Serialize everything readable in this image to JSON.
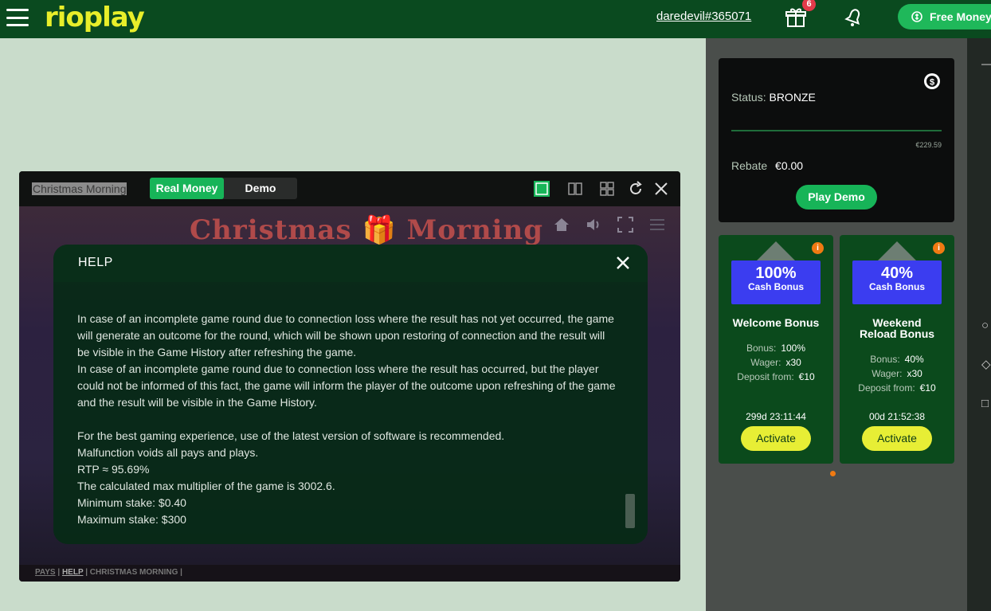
{
  "header": {
    "logo": "rioplay",
    "username": "daredevil#365071",
    "gift_badge": "6",
    "free_money_label": "Free Money"
  },
  "status_card": {
    "status_label": "Status:",
    "status_value": "BRONZE",
    "progress_fraction": 0.0,
    "progress_target": "€229.59",
    "rebate_label": "Rebate",
    "rebate_value": "€0.00",
    "play_demo_label": "Play Demo"
  },
  "bonuses": [
    {
      "pct": "100%",
      "type": "Cash Bonus",
      "title": "Welcome Bonus",
      "bonus_label": "Bonus:",
      "bonus_value": "100%",
      "wager_label": "Wager:",
      "wager_value": "x30",
      "deposit_label": "Deposit from:",
      "deposit_value": "€10",
      "timer": "299d  23:11:44",
      "activate_label": "Activate"
    },
    {
      "pct": "40%",
      "type": "Cash Bonus",
      "title": "Weekend Reload Bonus",
      "bonus_label": "Bonus:",
      "bonus_value": "40%",
      "wager_label": "Wager:",
      "wager_value": "x30",
      "deposit_label": "Deposit from:",
      "deposit_value": "€10",
      "timer": "00d  21:52:38",
      "activate_label": "Activate"
    }
  ],
  "game": {
    "title": "Christmas Morning",
    "mode_real": "Real Money",
    "mode_demo": "Demo",
    "logo_text": "Christmas 🎁 Morning",
    "help": {
      "title": "HELP",
      "paragraphs": [
        "In case of an incomplete game round due to connection loss where the result has not yet occurred, the game will generate an outcome for the round, which will be shown upon restoring of connection and the result will be visible in the Game History after refreshing the game.",
        "In case of an incomplete game round due to connection loss where the result has occurred, but the player could not be informed of this fact, the game will inform the player of the outcome upon refreshing of the game and the result will be visible in the Game History.",
        "",
        "For the best gaming experience, use of the latest version of software is recommended.",
        "Malfunction voids all pays and plays.",
        "RTP ≈ 95.69%",
        "The calculated max multiplier of the game is 3002.6.",
        "Minimum stake: $0.40",
        "Maximum stake: $300"
      ]
    },
    "footer": {
      "pays": "PAYS",
      "help": "HELP",
      "game_name": "CHRISTMAS MORNING"
    }
  }
}
